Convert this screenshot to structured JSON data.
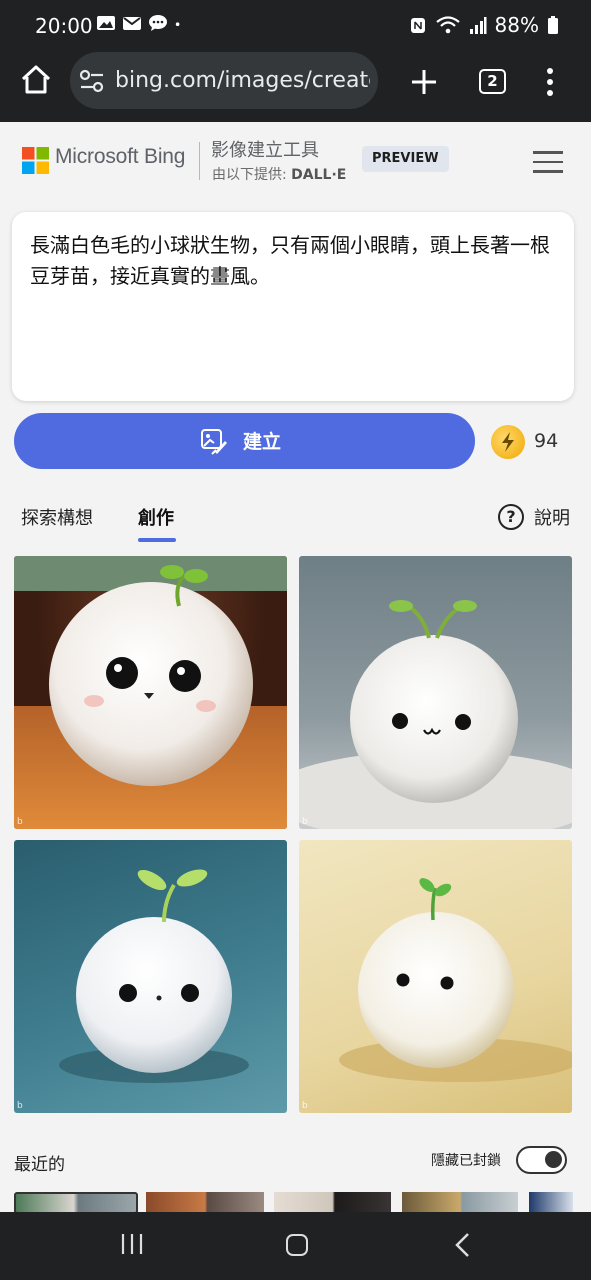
{
  "status_bar": {
    "time": "20:00",
    "battery": "88%",
    "icons": [
      "image-icon",
      "mail-icon",
      "chat-icon",
      "dot-icon",
      "nfc-icon",
      "wifi-icon",
      "signal-icon",
      "battery-icon"
    ]
  },
  "browser": {
    "url": "bing.com/images/create",
    "tab_count": "2"
  },
  "header": {
    "brand": "Microsoft Bing",
    "title": "影像建立工具",
    "subtitle_prefix": "由以下提供:",
    "subtitle_provider": "DALL·E",
    "badge": "PREVIEW"
  },
  "prompt": {
    "text": "長滿白色毛的小球狀生物，只有兩個小眼睛，頭上長著一根豆芽苗，接近真實的畫風。"
  },
  "actions": {
    "create_label": "建立",
    "boost_count": "94"
  },
  "tabs": {
    "explore": "探索構想",
    "create": "創作",
    "help": "說明"
  },
  "results": {
    "images": [
      {
        "name": "result-image-1",
        "icon": "image-icon"
      },
      {
        "name": "result-image-2",
        "icon": "image-icon"
      },
      {
        "name": "result-image-3",
        "icon": "image-icon"
      },
      {
        "name": "result-image-4",
        "icon": "image-icon"
      }
    ]
  },
  "recent": {
    "label": "最近的",
    "hide_blocked_label": "隱藏已封鎖",
    "toggle_on": true
  },
  "colors": {
    "accent": "#4f6bdf",
    "chrome_bg": "#1f2123",
    "page_bg": "#f3f3f3",
    "coin": "#f0a800"
  }
}
